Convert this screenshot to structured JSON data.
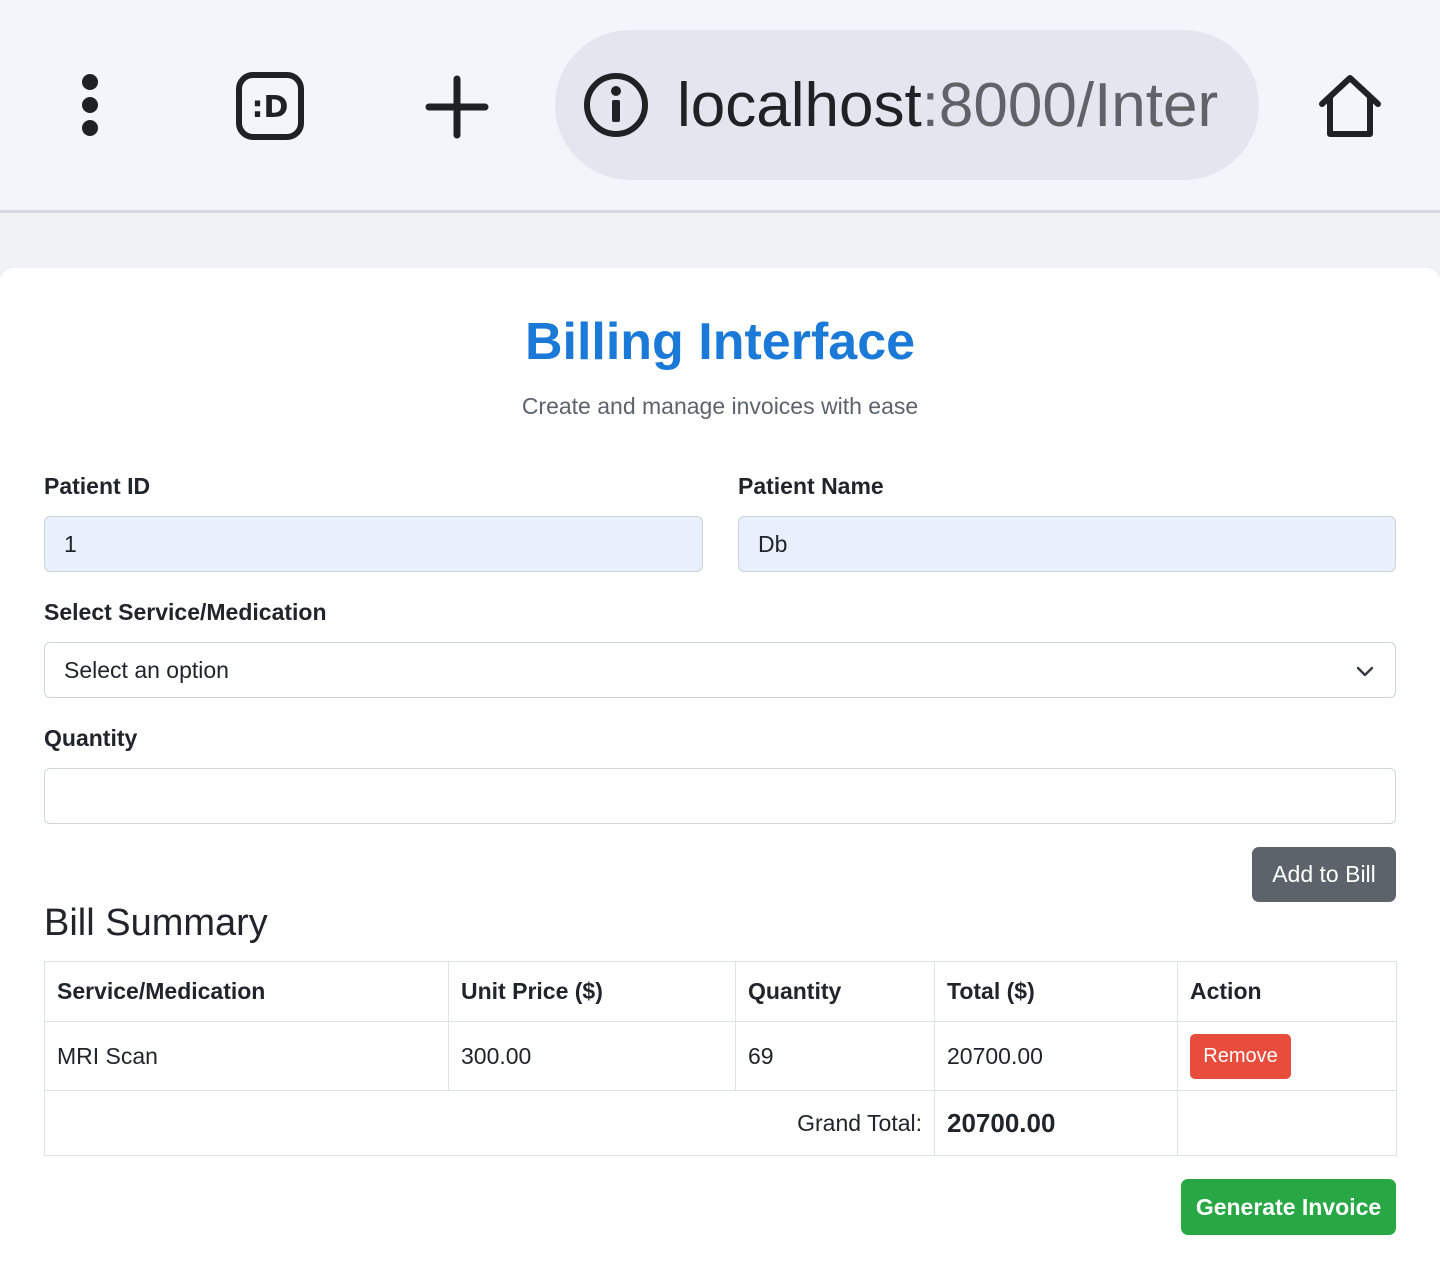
{
  "browser": {
    "url_host": "localhost",
    "url_rest": ":8000/Inter",
    "icons": [
      "more-vert-icon",
      "extension-icon",
      "plus-icon",
      "info-icon",
      "home-icon"
    ]
  },
  "page": {
    "title": "Billing Interface",
    "subtitle": "Create and manage invoices with ease"
  },
  "form": {
    "patient_id_label": "Patient ID",
    "patient_id_value": "1",
    "patient_name_label": "Patient Name",
    "patient_name_value": "Db",
    "service_label": "Select Service/Medication",
    "service_selected": "Select an option",
    "quantity_label": "Quantity",
    "quantity_value": "",
    "add_button": "Add to Bill"
  },
  "bill": {
    "title": "Bill Summary",
    "headers": [
      "Service/Medication",
      "Unit Price ($)",
      "Quantity",
      "Total ($)",
      "Action"
    ],
    "rows": [
      {
        "service": "MRI Scan",
        "unit_price": "300.00",
        "quantity": "69",
        "total": "20700.00",
        "action": "Remove"
      }
    ],
    "grand_total_label": "Grand Total:",
    "grand_total_value": "20700.00"
  },
  "generate_button": "Generate Invoice",
  "colors": {
    "title": "#1b79d8",
    "add_button": "#5c636a",
    "remove_button": "#e74c3c",
    "generate_button": "#28a745",
    "filled_input": "#e8f0fe"
  }
}
